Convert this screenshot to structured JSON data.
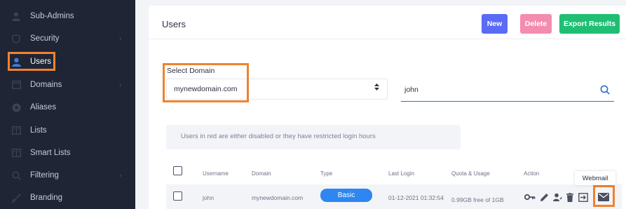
{
  "sidebar": {
    "items": [
      {
        "label": "Sub-Admins",
        "icon": "person-icon",
        "chevron": false
      },
      {
        "label": "Security",
        "icon": "shield-icon",
        "chevron": true
      },
      {
        "label": "Users",
        "icon": "user-icon",
        "chevron": false,
        "active": true
      },
      {
        "label": "Domains",
        "icon": "window-icon",
        "chevron": true
      },
      {
        "label": "Aliases",
        "icon": "at-icon",
        "chevron": false
      },
      {
        "label": "Lists",
        "icon": "list-icon",
        "chevron": false
      },
      {
        "label": "Smart Lists",
        "icon": "smart-list-icon",
        "chevron": false
      },
      {
        "label": "Filtering",
        "icon": "search-icon",
        "chevron": true
      },
      {
        "label": "Branding",
        "icon": "brush-icon",
        "chevron": false
      }
    ]
  },
  "header": {
    "title": "Users",
    "new_label": "New",
    "delete_label": "Delete",
    "export_label": "Export Results"
  },
  "filters": {
    "domain_label": "Select Domain",
    "domain_value": "mynewdomain.com",
    "search_value": "john"
  },
  "notice": "Users in red are either disabled or they have restricted login hours",
  "table": {
    "headers": [
      "Username",
      "Domain",
      "Type",
      "Last Login",
      "Quota & Usage",
      "Action"
    ],
    "rows": [
      {
        "username": "john",
        "domain": "mynewdomain.com",
        "type": "Basic",
        "last_login": "01-12-2021 01:32:54",
        "quota": "0.99GB free of 1GB"
      }
    ]
  },
  "tooltip": "Webmail",
  "colors": {
    "sidebar_bg": "#1f2535",
    "highlight": "#f0822e",
    "new_btn": "#5b6bf5",
    "delete_btn": "#f48cb0",
    "export_btn": "#1fbf73",
    "badge": "#2e86f1"
  }
}
